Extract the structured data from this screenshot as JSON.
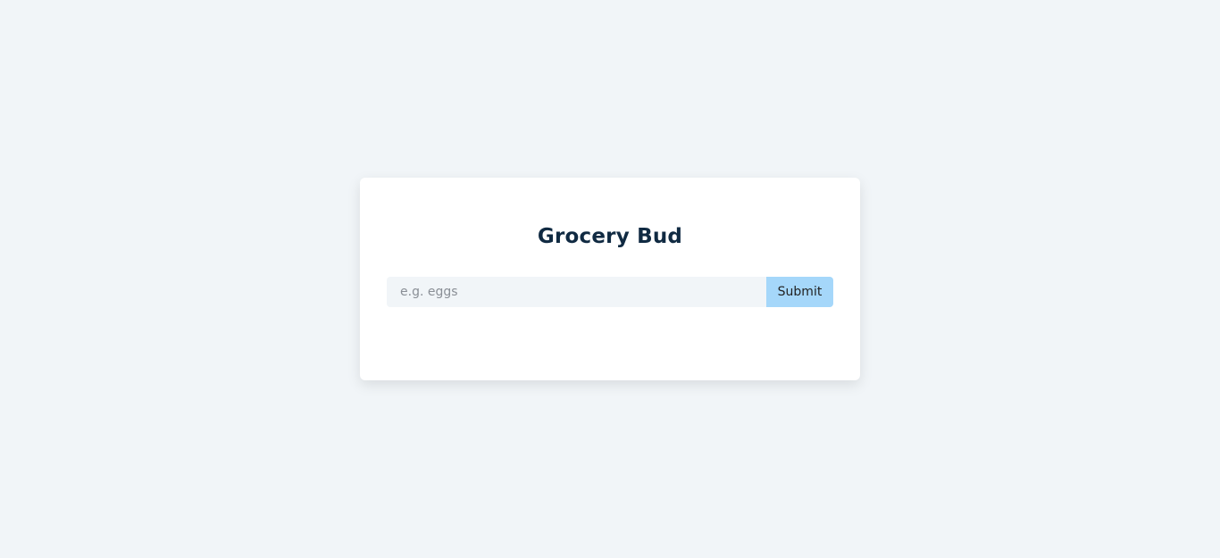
{
  "app": {
    "title": "Grocery Bud"
  },
  "form": {
    "input_placeholder": "e.g. eggs",
    "input_value": "",
    "submit_label": "Submit"
  },
  "colors": {
    "background": "#f1f5f8",
    "card": "#ffffff",
    "title": "#102a42",
    "submit": "#a5d7fa"
  }
}
